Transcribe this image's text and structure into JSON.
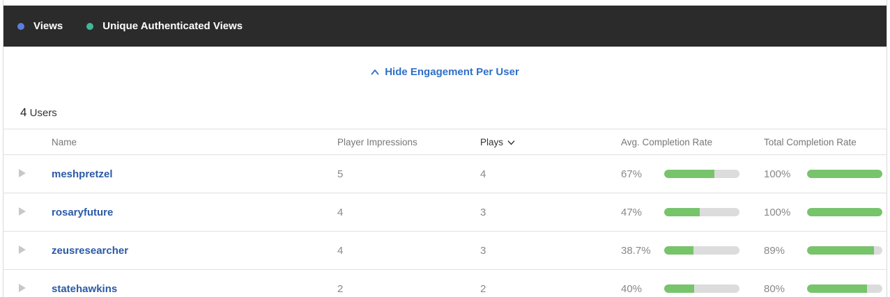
{
  "colors": {
    "views": "#5a7de0",
    "unique": "#3fb89a",
    "accent": "#2e6fc7",
    "bar_fill": "#77c46b",
    "bar_track": "#dcdcdc"
  },
  "legend": {
    "items": [
      {
        "label": "Views",
        "color": "#5a7de0"
      },
      {
        "label": "Unique Authenticated Views",
        "color": "#3fb89a"
      }
    ]
  },
  "toggle": {
    "label": "Hide Engagement Per User",
    "icon": "chevron-up-icon"
  },
  "users_count": {
    "number": "4",
    "label": "Users"
  },
  "table": {
    "columns": {
      "name": "Name",
      "impressions": "Player Impressions",
      "plays": "Plays",
      "avg": "Avg. Completion Rate",
      "total": "Total Completion Rate"
    },
    "sort_icon": "chevron-down-icon",
    "rows": [
      {
        "name": "meshpretzel",
        "impressions": "5",
        "plays": "4",
        "avg_text": "67%",
        "avg": 0.67,
        "total_text": "100%",
        "total": 1.0
      },
      {
        "name": "rosaryfuture",
        "impressions": "4",
        "plays": "3",
        "avg_text": "47%",
        "avg": 0.47,
        "total_text": "100%",
        "total": 1.0
      },
      {
        "name": "zeusresearcher",
        "impressions": "4",
        "plays": "3",
        "avg_text": "38.7%",
        "avg": 0.387,
        "total_text": "89%",
        "total": 0.89
      },
      {
        "name": "statehawkins",
        "impressions": "2",
        "plays": "2",
        "avg_text": "40%",
        "avg": 0.4,
        "total_text": "80%",
        "total": 0.8
      }
    ]
  }
}
